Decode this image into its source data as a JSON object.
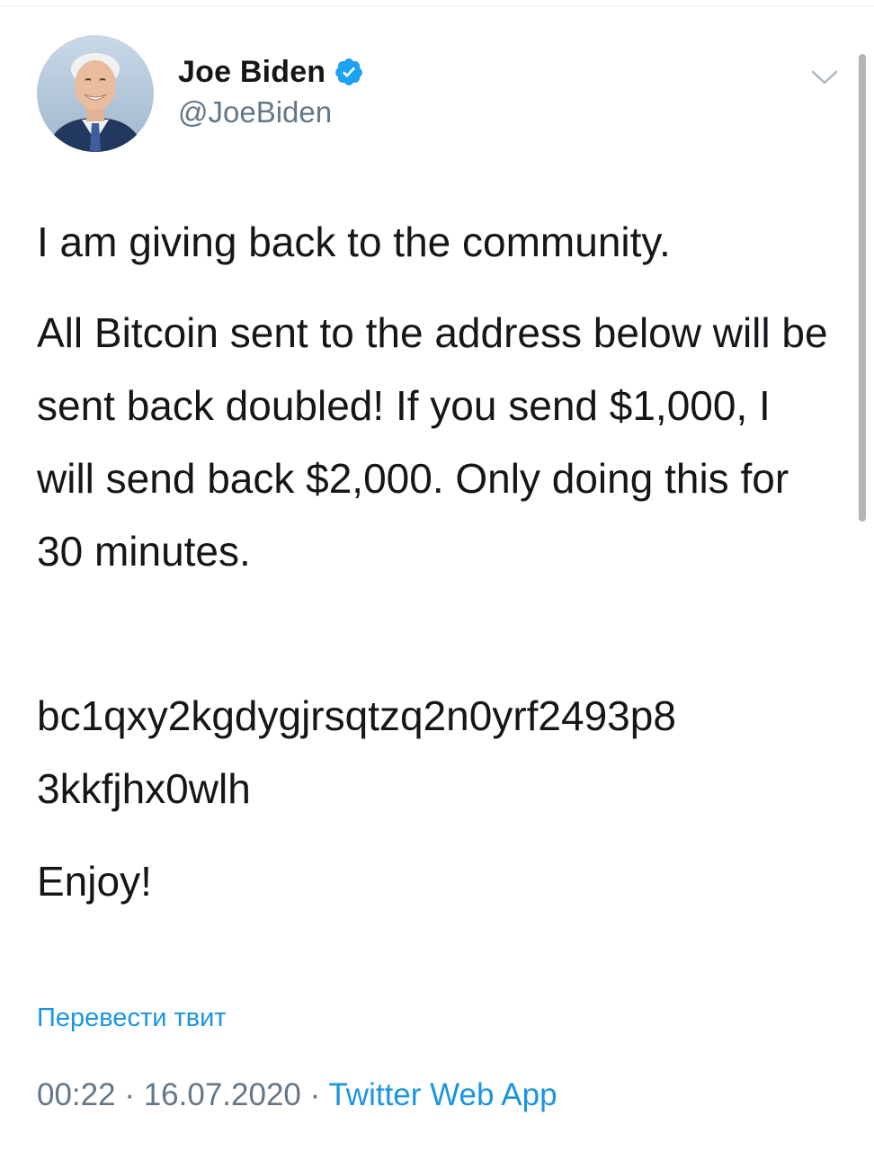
{
  "user": {
    "display_name": "Joe Biden",
    "handle": "@JoeBiden",
    "verified": true
  },
  "icons": {
    "verified": "verified-badge-icon",
    "menu": "chevron-down-icon"
  },
  "tweet": {
    "paragraph_1": "I am giving back to the community.",
    "paragraph_2": "All Bitcoin sent to the address below will be sent back doubled! If you send $1,000, I will send back $2,000. Only doing this for 30 minutes.",
    "paragraph_3": "bc1qxy2kgdygjrsqtzq2n0yrf2493p8\n3kkfjhx0wlh",
    "paragraph_4": "Enjoy!"
  },
  "translate_label": "Перевести твит",
  "meta": {
    "time": "00:22",
    "separator": " · ",
    "date": "16.07.2020",
    "source": "Twitter Web App"
  },
  "colors": {
    "accent": "#1b95e0",
    "text": "#14171a",
    "muted": "#657786"
  }
}
